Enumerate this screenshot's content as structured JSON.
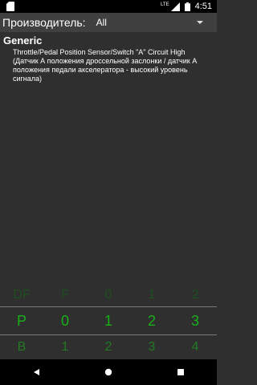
{
  "status_bar": {
    "time": "4:51",
    "network_label": "LTE",
    "icons": [
      "sd-card-icon",
      "signal-icon",
      "battery-icon"
    ]
  },
  "header": {
    "manufacturer_label": "Производитель:",
    "manufacturer_value": "All",
    "dropdown_icon": "triangle-down-icon"
  },
  "code": {
    "title": "Generic",
    "description_en": "Throttle/Pedal Position Sensor/Switch \"A\" Circuit High",
    "description_ru": "(Датчик А положения дроссельной заслонки / датчик А положения педали акселератора - высокий уровень сигнала)"
  },
  "picker": {
    "columns": [
      {
        "above": "DF",
        "selected": "P",
        "below": "B"
      },
      {
        "above": "F",
        "selected": "0",
        "below": "1"
      },
      {
        "above": "0",
        "selected": "1",
        "below": "2"
      },
      {
        "above": "1",
        "selected": "2",
        "below": "3"
      },
      {
        "above": "2",
        "selected": "3",
        "below": "4"
      }
    ],
    "colors": {
      "selected": "#18b018",
      "above": "#1e4f1e",
      "below": "#237a23"
    }
  },
  "nav_bar": {
    "icons": [
      "back-icon",
      "home-icon",
      "recents-icon"
    ]
  },
  "colors": {
    "background": "#2f2f2f",
    "header": "#404040",
    "status_bar": "#000000"
  }
}
